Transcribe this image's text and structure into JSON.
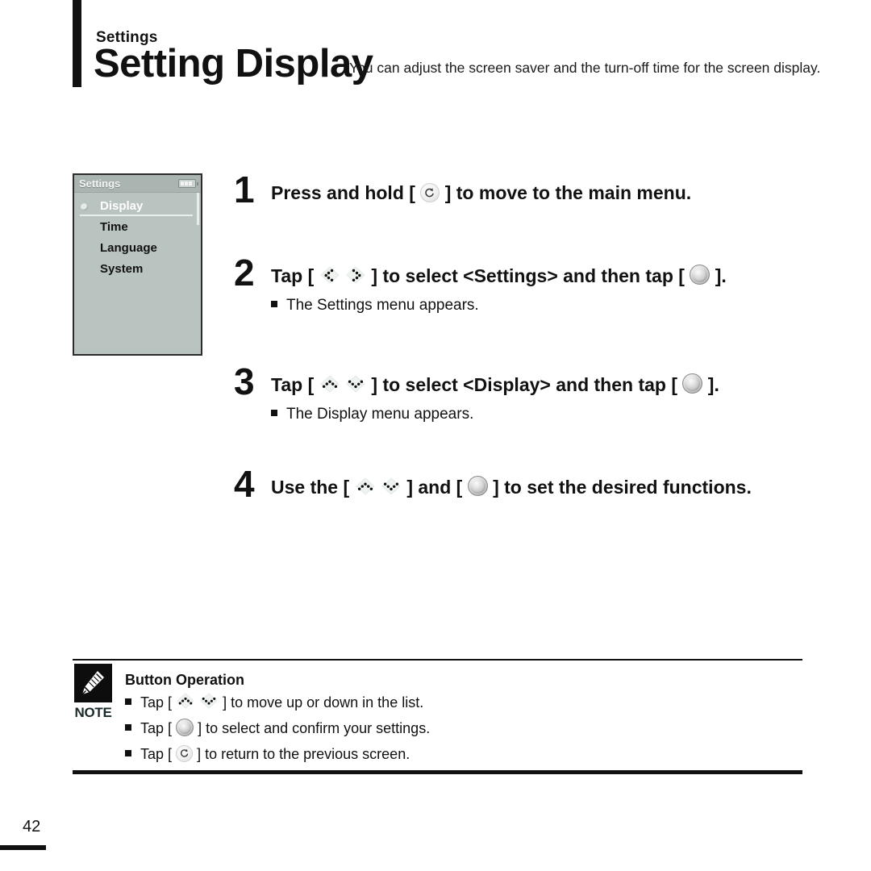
{
  "header": {
    "eyebrow": "Settings",
    "title": "Setting Display",
    "subtitle": "You can adjust the screen saver and the turn-off time for the screen display."
  },
  "device_screen": {
    "titlebar": {
      "title": "Settings",
      "battery_icon": "battery-icon",
      "battery_bars": 3
    },
    "items": [
      {
        "label": "Display",
        "selected": true
      },
      {
        "label": "Time",
        "selected": false
      },
      {
        "label": "Language",
        "selected": false
      },
      {
        "label": "System",
        "selected": false
      }
    ],
    "colors": {
      "screen_bg": "#b9c3bf",
      "titlebar_bg": "#aab4b1",
      "selected_text": "#ffffff",
      "item_text": "#111111"
    }
  },
  "steps": [
    {
      "number": "1",
      "text_before": "Press and hold [",
      "icon": "return-icon",
      "text_after": "] to move to the main menu.",
      "sub": null
    },
    {
      "number": "2",
      "text_before": "Tap [",
      "icon_left": "chevron-left-icon",
      "icon_right": "chevron-right-icon",
      "text_middle": "] to select <Settings> and then tap [",
      "icon_select": "select-button-icon",
      "text_after": "].",
      "sub": "The Settings menu appears."
    },
    {
      "number": "3",
      "text_before": "Tap [",
      "icon_up": "chevron-up-icon",
      "icon_down": "chevron-down-icon",
      "text_middle": "] to select <Display> and then tap [",
      "icon_select": "select-button-icon",
      "text_after": "].",
      "sub": "The Display menu appears."
    },
    {
      "number": "4",
      "text_before": "Use the [",
      "icon_up": "chevron-up-icon",
      "icon_down": "chevron-down-icon",
      "text_middle": "] and [",
      "icon_select": "select-button-icon",
      "text_after": "] to set the desired functions.",
      "sub": null
    }
  ],
  "note": {
    "badge_icon": "pencil-icon",
    "badge_label": "NOTE",
    "title": "Button Operation",
    "lines": [
      {
        "before": "Tap [",
        "icons": [
          "chevron-up-icon",
          "chevron-down-icon"
        ],
        "after": "] to move up or down in the list."
      },
      {
        "before": "Tap [",
        "icons": [
          "select-button-icon"
        ],
        "after": "] to select and confirm your settings."
      },
      {
        "before": "Tap [",
        "icons": [
          "return-icon"
        ],
        "after": "] to return to the previous screen."
      }
    ]
  },
  "footer": {
    "page_number": "42"
  }
}
